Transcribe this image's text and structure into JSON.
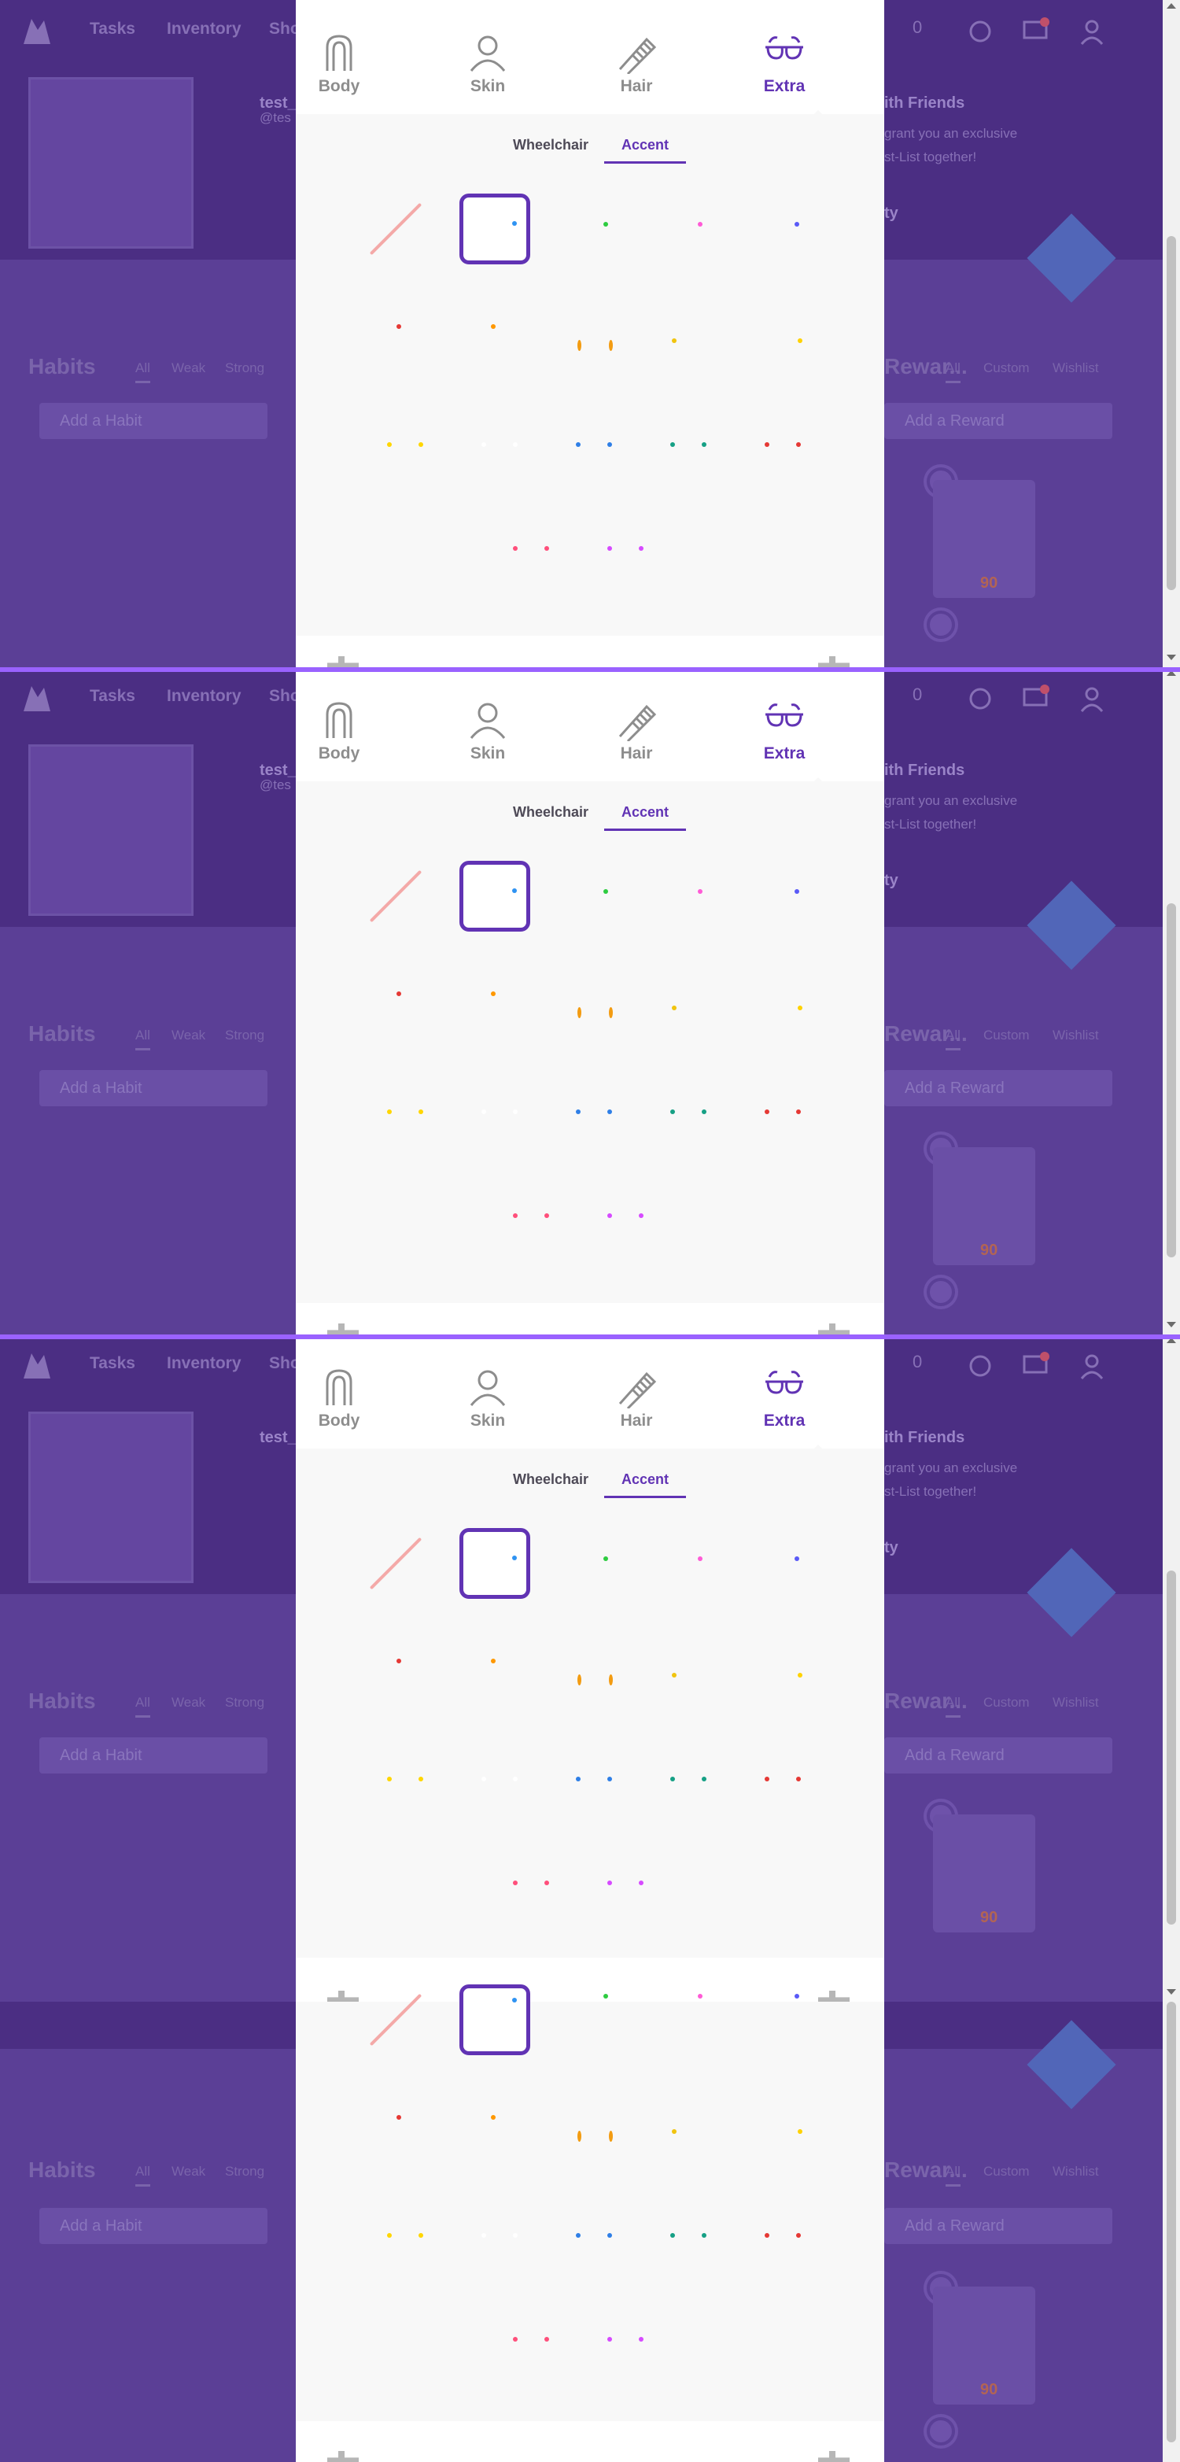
{
  "header": {
    "nav": [
      {
        "label": "Tasks"
      },
      {
        "label": "Inventory"
      },
      {
        "label": "Sho"
      }
    ],
    "gems": "0"
  },
  "hero": {
    "username": "test_",
    "handle": "@tes",
    "party_title": "ith Friends",
    "party_text_1": "grant you an exclusive",
    "party_text_2": "st-List together!",
    "party_link": "ty"
  },
  "habits": {
    "title": "Habits",
    "filters": [
      "All",
      "Weak",
      "Strong"
    ],
    "add_placeholder": "Add a Habit"
  },
  "rewards": {
    "title": "Rewar...",
    "filters": [
      "All",
      "Custom",
      "Wishlist"
    ],
    "add_placeholder": "Add a Reward",
    "price": "90"
  },
  "modal": {
    "categories": [
      {
        "label": "Body",
        "icon": "body-icon"
      },
      {
        "label": "Skin",
        "icon": "skin-icon"
      },
      {
        "label": "Hair",
        "icon": "hair-icon"
      },
      {
        "label": "Extra",
        "icon": "glasses-icon"
      }
    ],
    "active_category": "Extra",
    "subtabs": [
      {
        "label": "Wheelchair"
      },
      {
        "label": "Accent"
      }
    ],
    "active_subtab": "Accent",
    "accent_colors": {
      "row1": [
        "none",
        "#2f93f2",
        "#2ecc40",
        "#ff5bd6",
        "#5a5af7"
      ],
      "row2": [
        "#e53935",
        "#ff9800",
        "#f39c12",
        "#f1c40f",
        "#ffd200"
      ],
      "row3": [
        "#ffd600",
        "#ffffff",
        "#2f7fe6",
        "#16a085",
        "#e53935"
      ],
      "row4": [
        "#ff4f7b",
        "#d64bff"
      ]
    },
    "selected_option": "row1.1"
  }
}
